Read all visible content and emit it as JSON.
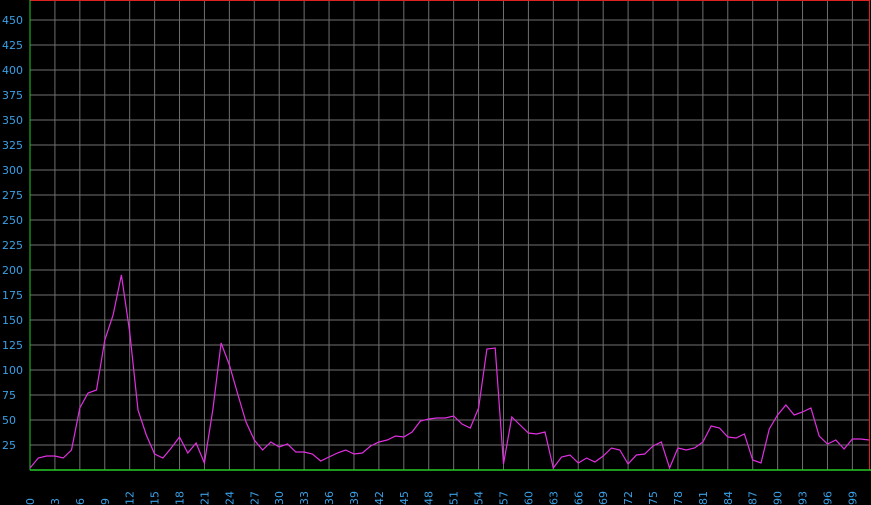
{
  "chart_data": {
    "type": "line",
    "title": "",
    "xlabel": "",
    "ylabel": "",
    "xlim": [
      0,
      101
    ],
    "ylim": [
      0,
      470
    ],
    "grid": true,
    "y_ticks": [
      25,
      50,
      75,
      100,
      125,
      150,
      175,
      200,
      225,
      250,
      275,
      300,
      325,
      350,
      375,
      400,
      425,
      450
    ],
    "x_ticks": [
      0,
      3,
      6,
      9,
      12,
      15,
      18,
      21,
      24,
      27,
      30,
      33,
      36,
      39,
      42,
      45,
      48,
      51,
      54,
      57,
      60,
      63,
      66,
      69,
      72,
      75,
      78,
      81,
      84,
      87,
      90,
      93,
      96,
      99
    ],
    "series": [
      {
        "color": "#e030e0",
        "x": [
          0,
          1,
          2,
          3,
          4,
          5,
          6,
          7,
          8,
          9,
          10,
          11,
          12,
          13,
          14,
          15,
          16,
          17,
          18,
          19,
          20,
          21,
          22,
          23,
          24,
          25,
          26,
          27,
          28,
          29,
          30,
          31,
          32,
          33,
          34,
          35,
          36,
          37,
          38,
          39,
          40,
          41,
          42,
          43,
          44,
          45,
          46,
          47,
          48,
          49,
          50,
          51,
          52,
          53,
          54,
          55,
          56,
          57,
          58,
          59,
          60,
          61,
          62,
          63,
          64,
          65,
          66,
          67,
          68,
          69,
          70,
          71,
          72,
          73,
          74,
          75,
          76,
          77,
          78,
          79,
          80,
          81,
          82,
          83,
          84,
          85,
          86,
          87,
          88,
          89,
          90,
          91,
          92,
          93,
          94,
          95,
          96,
          97,
          98,
          99,
          100,
          101
        ],
        "y": [
          2,
          12,
          14,
          14,
          12,
          20,
          62,
          77,
          80,
          130,
          155,
          195,
          138,
          60,
          35,
          16,
          12,
          22,
          33,
          17,
          27,
          7,
          60,
          127,
          105,
          76,
          48,
          30,
          20,
          28,
          23,
          26,
          18,
          18,
          16,
          9,
          13,
          17,
          20,
          16,
          17,
          24,
          28,
          30,
          34,
          33,
          38,
          49,
          51,
          52,
          52,
          54,
          46,
          42,
          62,
          121,
          122,
          6,
          53,
          45,
          37,
          36,
          38,
          2,
          13,
          15,
          7,
          12,
          8,
          14,
          22,
          20,
          6,
          15,
          16,
          24,
          28,
          2,
          22,
          20,
          22,
          28,
          44,
          42,
          33,
          32,
          36,
          10,
          7,
          41,
          55,
          65,
          55,
          58,
          62,
          34,
          26,
          30,
          21,
          31,
          31,
          30
        ]
      }
    ]
  }
}
